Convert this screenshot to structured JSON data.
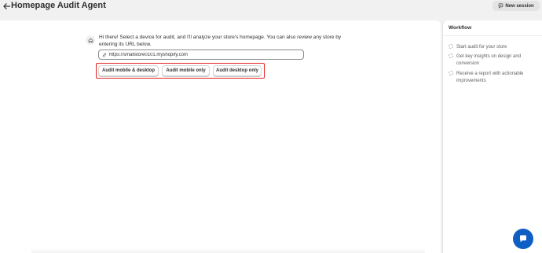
{
  "header": {
    "back_icon": "arrow-left-icon",
    "title": "Homepage Audit Agent",
    "new_session_label": "New session",
    "new_session_icon": "chat-bubble-icon"
  },
  "chat": {
    "avatar_icon": "home-icon",
    "intro_text": "Hi there! Select a device for audit, and I'll analyze your store's homepage. You can also review any store by entering its URL below.",
    "url_icon": "link-icon",
    "url_value": "https://smallstore0101.myshopify.com",
    "buttons": [
      {
        "label": "Audit mobile & desktop"
      },
      {
        "label": "Audit mobile only"
      },
      {
        "label": "Audit desktop only"
      }
    ],
    "highlight_color": "#e02424"
  },
  "workflow": {
    "title": "Workflow",
    "steps": [
      {
        "label": "Start audit for your store"
      },
      {
        "label": "Get key insights on design and conversion"
      },
      {
        "label": "Receive a report with actionable improvements"
      }
    ]
  },
  "support": {
    "icon": "chat-icon",
    "color": "#0e5ec4"
  }
}
